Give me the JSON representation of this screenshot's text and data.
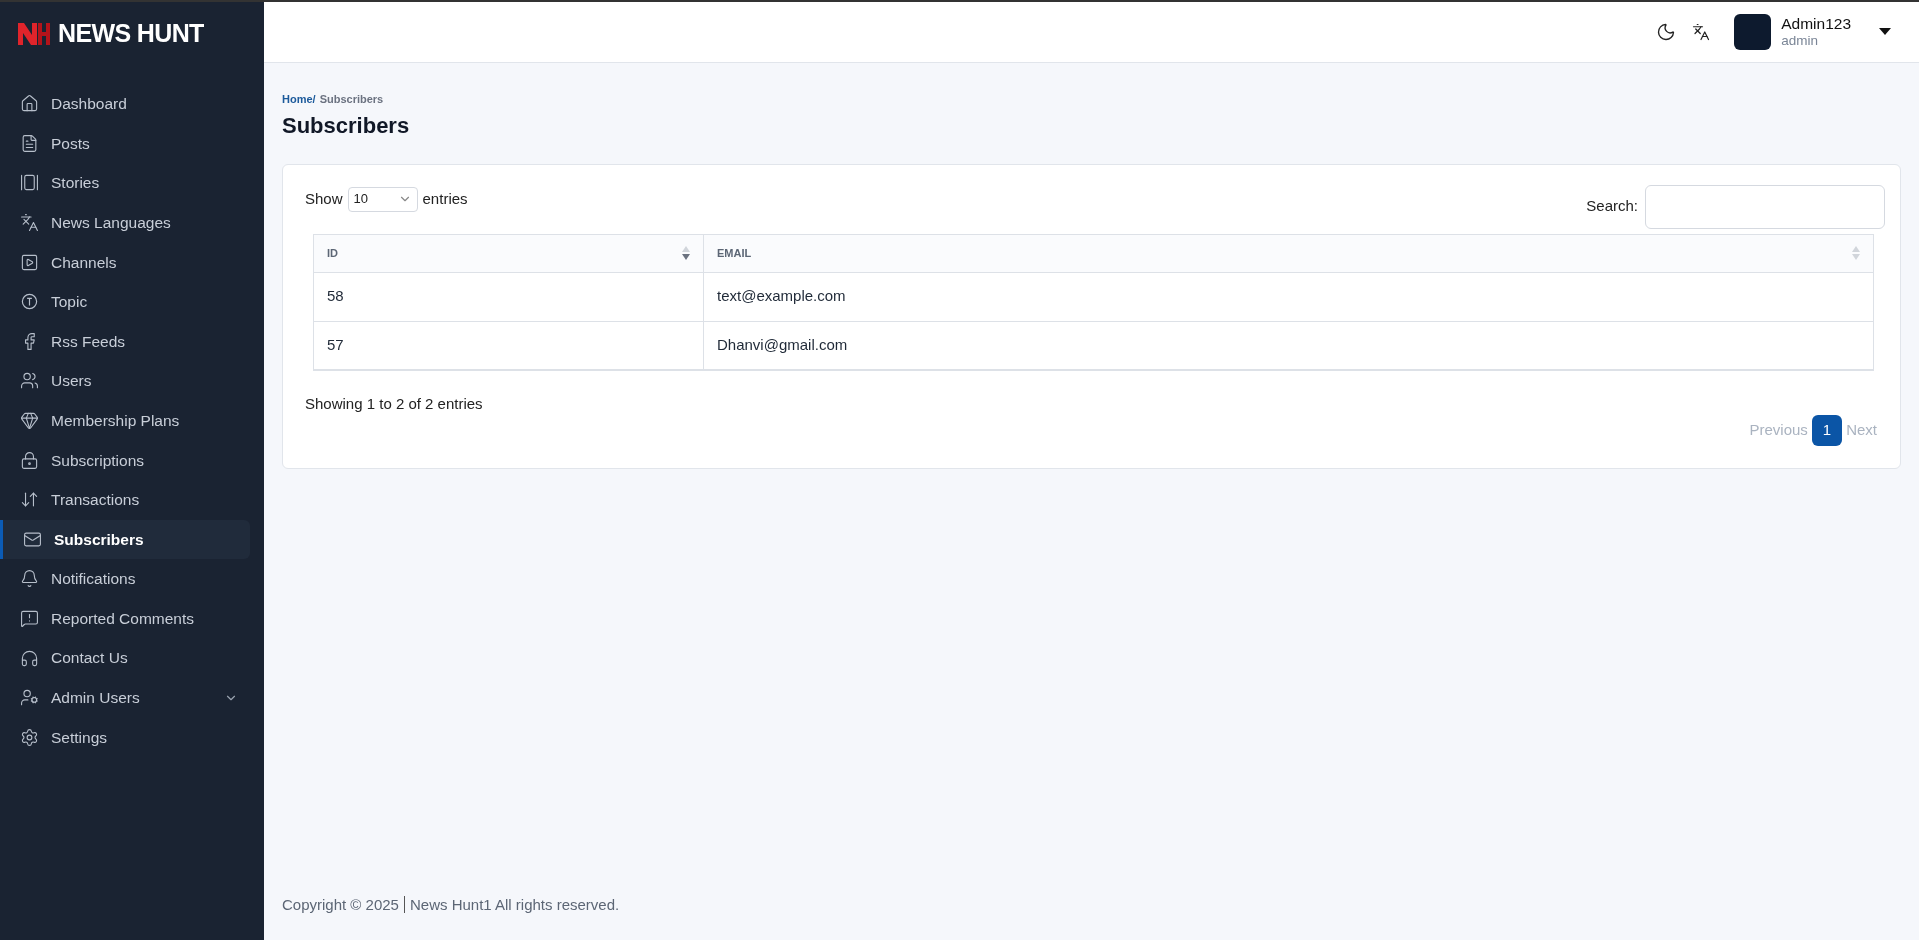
{
  "brand": {
    "name": "NEWS HUNT"
  },
  "sidebar": {
    "items": [
      {
        "label": "Dashboard",
        "selected": false
      },
      {
        "label": "Posts",
        "selected": false
      },
      {
        "label": "Stories",
        "selected": false
      },
      {
        "label": "News Languages",
        "selected": false
      },
      {
        "label": "Channels",
        "selected": false
      },
      {
        "label": "Topic",
        "selected": false
      },
      {
        "label": "Rss Feeds",
        "selected": false
      },
      {
        "label": "Users",
        "selected": false
      },
      {
        "label": "Membership Plans",
        "selected": false
      },
      {
        "label": "Subscriptions",
        "selected": false
      },
      {
        "label": "Transactions",
        "selected": false
      },
      {
        "label": "Subscribers",
        "selected": true
      },
      {
        "label": "Notifications",
        "selected": false
      },
      {
        "label": "Reported Comments",
        "selected": false
      },
      {
        "label": "Contact Us",
        "selected": false
      },
      {
        "label": "Admin Users",
        "selected": false,
        "expanded": false
      },
      {
        "label": "Settings",
        "selected": false
      }
    ]
  },
  "header": {
    "user_name": "Admin123",
    "user_role": "admin"
  },
  "breadcrumb": {
    "home": "Home/",
    "current": "Subscribers"
  },
  "page_title": "Subscribers",
  "table_controls": {
    "show_label": "Show",
    "page_size": "10",
    "entries_label": "entries",
    "search_label": "Search:"
  },
  "table": {
    "columns": [
      {
        "label": "ID",
        "sorted": true
      },
      {
        "label": "EMAIL",
        "sorted": false
      }
    ],
    "rows": [
      [
        "58",
        "text@example.com"
      ],
      [
        "57",
        "Dhanvi@gmail.com"
      ]
    ]
  },
  "table_info": "Showing 1 to 2 of 2 entries",
  "pagination": [
    {
      "label": "Previous",
      "kind": "nav",
      "disabled": true,
      "selected": false
    },
    {
      "label": "1",
      "kind": "page",
      "disabled": false,
      "selected": true
    },
    {
      "label": "Next",
      "kind": "nav",
      "disabled": true,
      "selected": false
    }
  ],
  "footer": {
    "copyright": "Copyright © 2025",
    "text": "News Hunt1 All rights reserved."
  }
}
